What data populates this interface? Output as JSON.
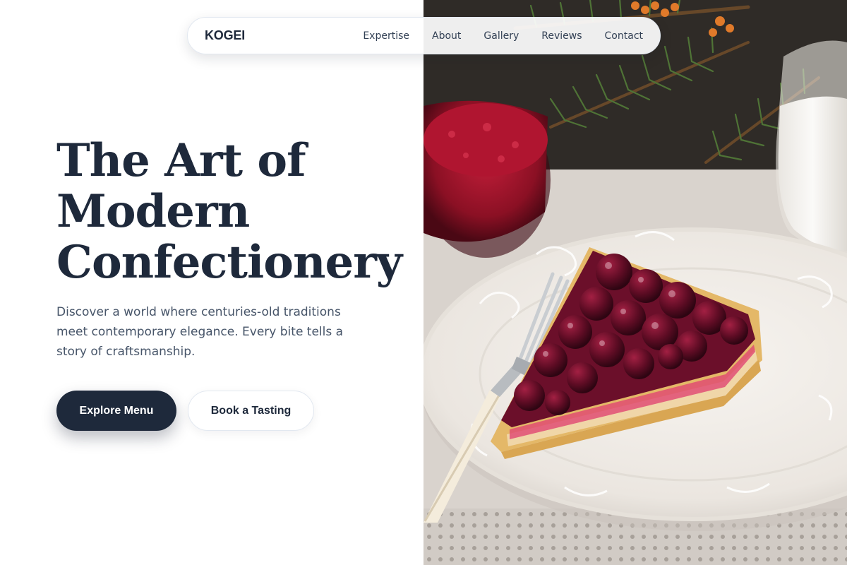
{
  "nav": {
    "brand": "KOGEI",
    "links": [
      "Expertise",
      "About",
      "Gallery",
      "Reviews",
      "Contact"
    ]
  },
  "hero": {
    "title_lines": [
      "The Art of",
      "Modern",
      "Confectionery"
    ],
    "subtitle": "Discover a world where centuries-old traditions meet contemporary elegance. Every bite tells a story of craftsmanship.",
    "primary_cta": "Explore Menu",
    "secondary_cta": "Book a Tasting"
  },
  "image": {
    "subject": "cherry-tart-slice",
    "colors": {
      "cherry": "#6b0f2a",
      "plate": "#f3f0ec",
      "crust": "#e2b86a",
      "fir": "#3d5a2a",
      "primary_button": "#1e293b"
    }
  }
}
